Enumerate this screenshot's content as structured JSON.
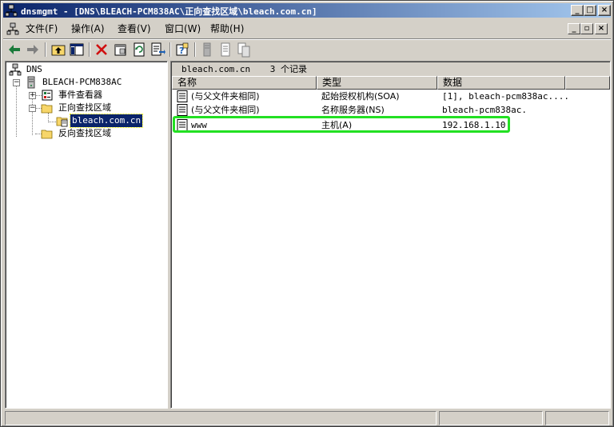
{
  "window": {
    "title": "dnsmgmt - [DNS\\BLEACH-PCM838AC\\正向查找区域\\bleach.com.cn]",
    "minimize_label": "_",
    "maximize_label": "□",
    "close_label": "×"
  },
  "menu": {
    "items": [
      {
        "label": "文件(F)"
      },
      {
        "label": "操作(A)"
      },
      {
        "label": "查看(V)"
      },
      {
        "label": "窗口(W)"
      },
      {
        "label": "帮助(H)"
      }
    ],
    "mdi_min": "_",
    "mdi_restore": "▫",
    "mdi_close": "×"
  },
  "toolbar": {
    "icons": [
      "back-arrow-icon",
      "forward-arrow-icon",
      "up-folder-icon",
      "show-hide-tree-icon",
      "delete-icon",
      "properties-icon",
      "refresh-icon",
      "export-list-icon",
      "help-icon",
      "server-icon",
      "record-icon",
      "copy-record-icon"
    ]
  },
  "tree": {
    "root": "DNS",
    "server": "BLEACH-PCM838AC",
    "event_viewer": "事件查看器",
    "forward_zones": "正向查找区域",
    "zone": "bleach.com.cn",
    "reverse_zones": "反向查找区域"
  },
  "list": {
    "zone_name": "bleach.com.cn",
    "record_count": "3 个记录",
    "columns": [
      "名称",
      "类型",
      "数据"
    ],
    "rows": [
      {
        "name": "(与父文件夹相同)",
        "type": "起始授权机构(SOA)",
        "data": "[1], bleach-pcm838ac...."
      },
      {
        "name": "(与父文件夹相同)",
        "type": "名称服务器(NS)",
        "data": "bleach-pcm838ac."
      },
      {
        "name": "www",
        "type": "主机(A)",
        "data": "192.168.1.10"
      }
    ],
    "highlight_color": "#22e022"
  },
  "colors": {
    "titlebar_start": "#0a246a",
    "titlebar_end": "#a6caf0",
    "face": "#d4d0c8",
    "selection": "#0a246a"
  }
}
